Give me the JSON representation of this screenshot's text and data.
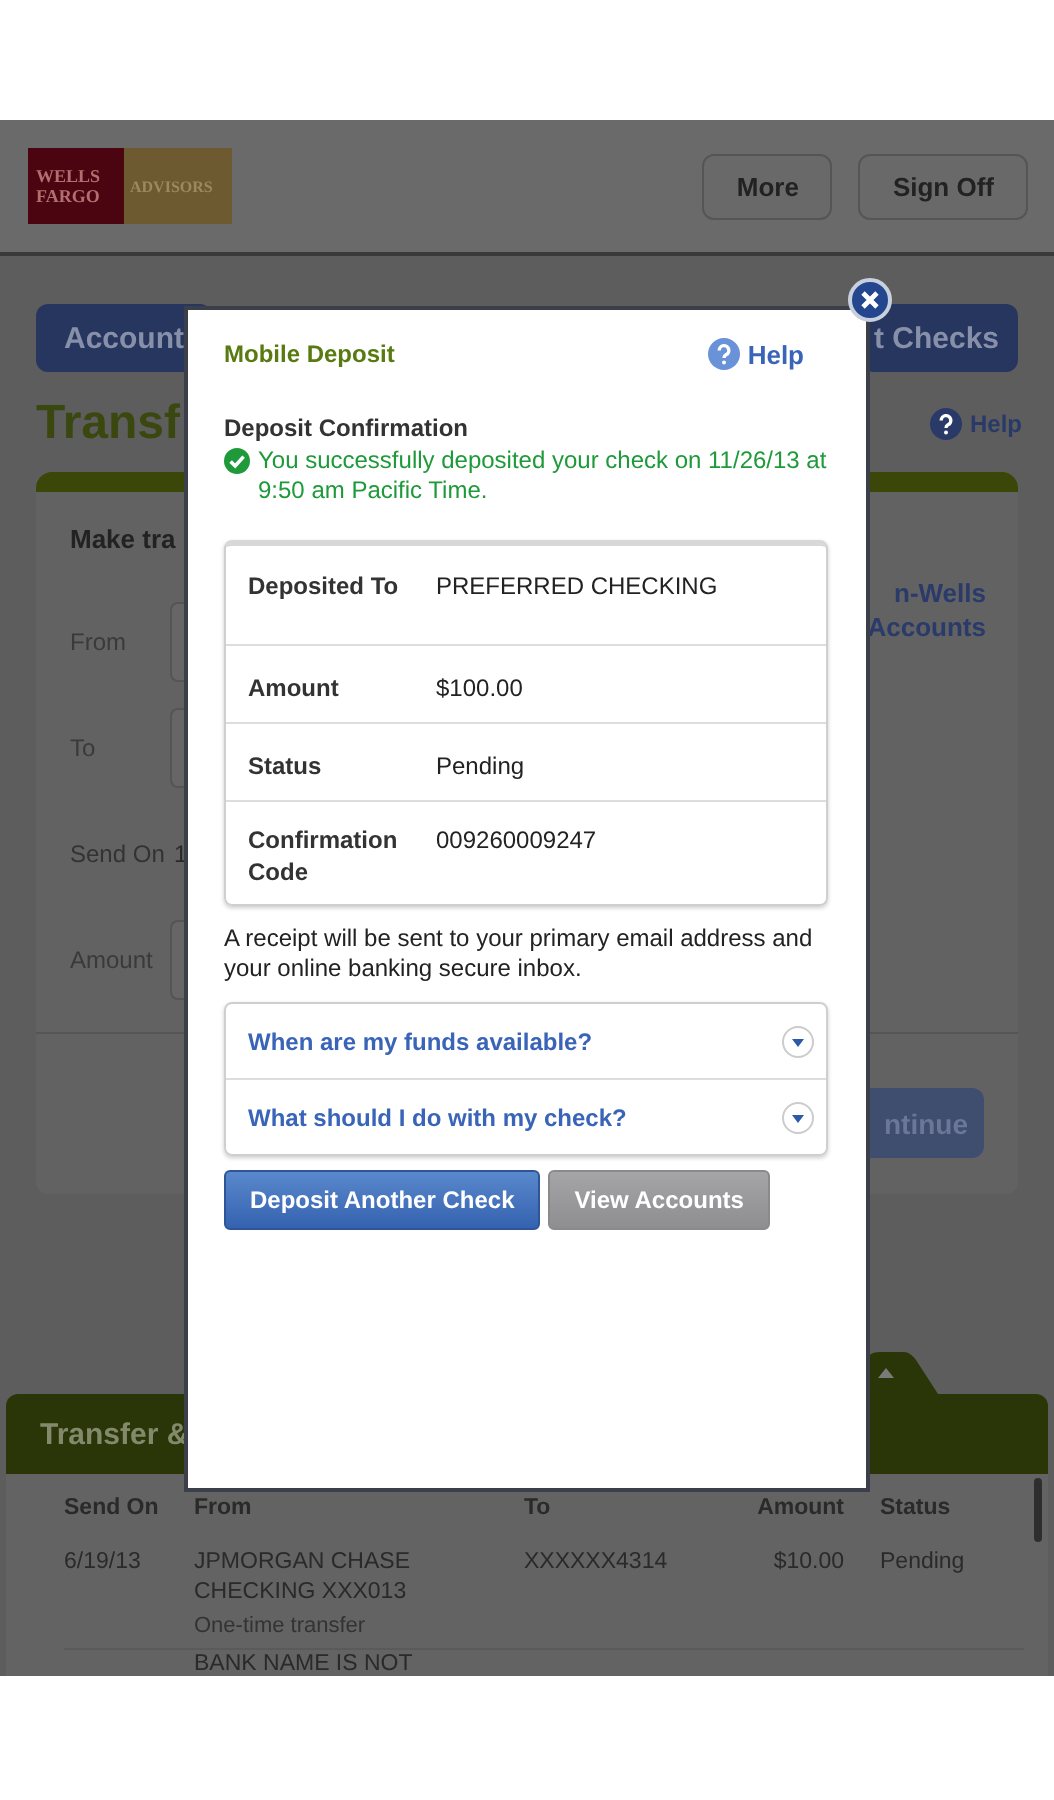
{
  "header": {
    "logo_primary": "WELLS FARGO",
    "logo_secondary": "ADVISORS",
    "buttons": [
      "More",
      "Sign Off"
    ]
  },
  "nav_tabs": [
    {
      "label": "Account"
    },
    {
      "label": "t Checks"
    }
  ],
  "page": {
    "title": "Transf",
    "help": "Help"
  },
  "transfer_form": {
    "title": "Make tra",
    "fields": [
      {
        "label": "From",
        "kind": "box"
      },
      {
        "label": "To",
        "kind": "box"
      },
      {
        "label": "Send On",
        "kind": "text",
        "value": "1"
      },
      {
        "label": "Amount",
        "kind": "box"
      }
    ],
    "side_link": "n-Wells Accounts",
    "button": "ntinue"
  },
  "activity": {
    "title": "Transfer &",
    "columns": [
      "Send On",
      "From",
      "To",
      "Amount",
      "Status"
    ],
    "rows": [
      {
        "send_on": "6/19/13",
        "from": "JPMORGAN CHASE CHECKING XXX013",
        "note": "One-time transfer",
        "to": "XXXXXX4314",
        "amount": "$10.00",
        "status": "Pending"
      },
      {
        "from": "BANK NAME IS NOT"
      }
    ]
  },
  "dialog": {
    "title": "Mobile Deposit",
    "help": "Help",
    "heading": "Deposit Confirmation",
    "message": "You successfully deposited your check on 11/26/13 at 9:50 am Pacific Time.",
    "details": [
      {
        "label": "Deposited To",
        "value": "PREFERRED CHECKING"
      },
      {
        "label": "Amount",
        "value": "$100.00"
      },
      {
        "label": "Status",
        "value": "Pending"
      },
      {
        "label": "Confirmation Code",
        "value": "009260009247"
      }
    ],
    "note": "A receipt will be sent to your primary email address and your online banking secure inbox.",
    "faqs": [
      {
        "question": "When are my funds available?",
        "expanded": false
      },
      {
        "question": "What should I do with my check?",
        "expanded": false
      }
    ],
    "buttons": [
      {
        "label": "Deposit Another Check",
        "kind": "primary"
      },
      {
        "label": "View Accounts",
        "kind": "secondary"
      }
    ]
  }
}
